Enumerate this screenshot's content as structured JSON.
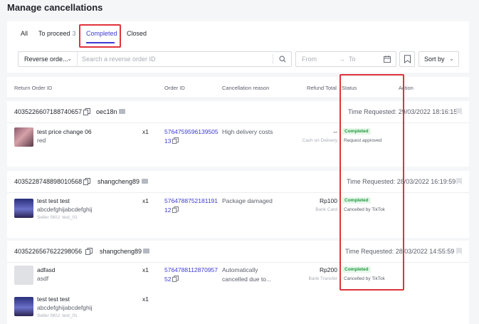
{
  "page_title": "Manage cancellations",
  "tabs": [
    {
      "label": "All",
      "count": ""
    },
    {
      "label": "To proceed",
      "count": "3"
    },
    {
      "label": "Completed",
      "count": ""
    },
    {
      "label": "Closed",
      "count": ""
    }
  ],
  "active_tab": "Completed",
  "filters": {
    "search_type": "Reverse orde...",
    "search_placeholder": "Search a reverse order ID",
    "date_from": "From",
    "date_arrow": "→",
    "date_to": "To",
    "sort_label": "Sort by"
  },
  "columns": [
    "Return Order ID",
    "Order ID",
    "Cancellation reason",
    "Refund Total",
    "Status",
    "Action"
  ],
  "groups": [
    {
      "return_id": "4035226607188740657",
      "buyer": "oec18n",
      "time_requested": "Time Requested: 29/03/2022 18:16:15",
      "rows": [
        {
          "product": "test price change 06",
          "variant": "red",
          "sku": "",
          "qty": "x1",
          "order_id": "576475959613950513",
          "reason": "High delivery costs",
          "refund": "--",
          "refund_method": "Cash on Delivery",
          "status": "Completed",
          "status_detail": "Request approved"
        }
      ]
    },
    {
      "return_id": "4035228748898010568",
      "buyer": "shangcheng89",
      "time_requested": "Time Requested: 28/03/2022 16:19:59",
      "rows": [
        {
          "product": "test test test",
          "variant": "abcdefghijabcdefghij",
          "sku": "Seller SKU: test_01",
          "qty": "x1",
          "order_id": "576478875218119112",
          "reason": "Package damaged",
          "refund": "Rp100",
          "refund_method": "Bank Card",
          "status": "Completed",
          "status_detail": "Cancelled by TikTok"
        }
      ]
    },
    {
      "return_id": "4035226567622298056",
      "buyer": "shangcheng89",
      "time_requested": "Time Requested: 28/03/2022 14:55:59",
      "rows": [
        {
          "product": "adfasd",
          "variant": "asdf",
          "sku": "",
          "qty": "x1",
          "order_id": "576478811287095752",
          "reason": "Automatically cancelled due to...",
          "refund": "Rp200",
          "refund_method": "Bank Transfer",
          "status": "Completed",
          "status_detail": "Cancelled by TikTok"
        },
        {
          "product": "test test test",
          "variant": "abcdefghijabcdefghij",
          "sku": "Seller SKU: test_01",
          "qty": "x1"
        }
      ]
    }
  ],
  "colors": {
    "accent": "#3c3ad6",
    "highlight": "#e0333b",
    "status_green": "#1f9b3f"
  }
}
